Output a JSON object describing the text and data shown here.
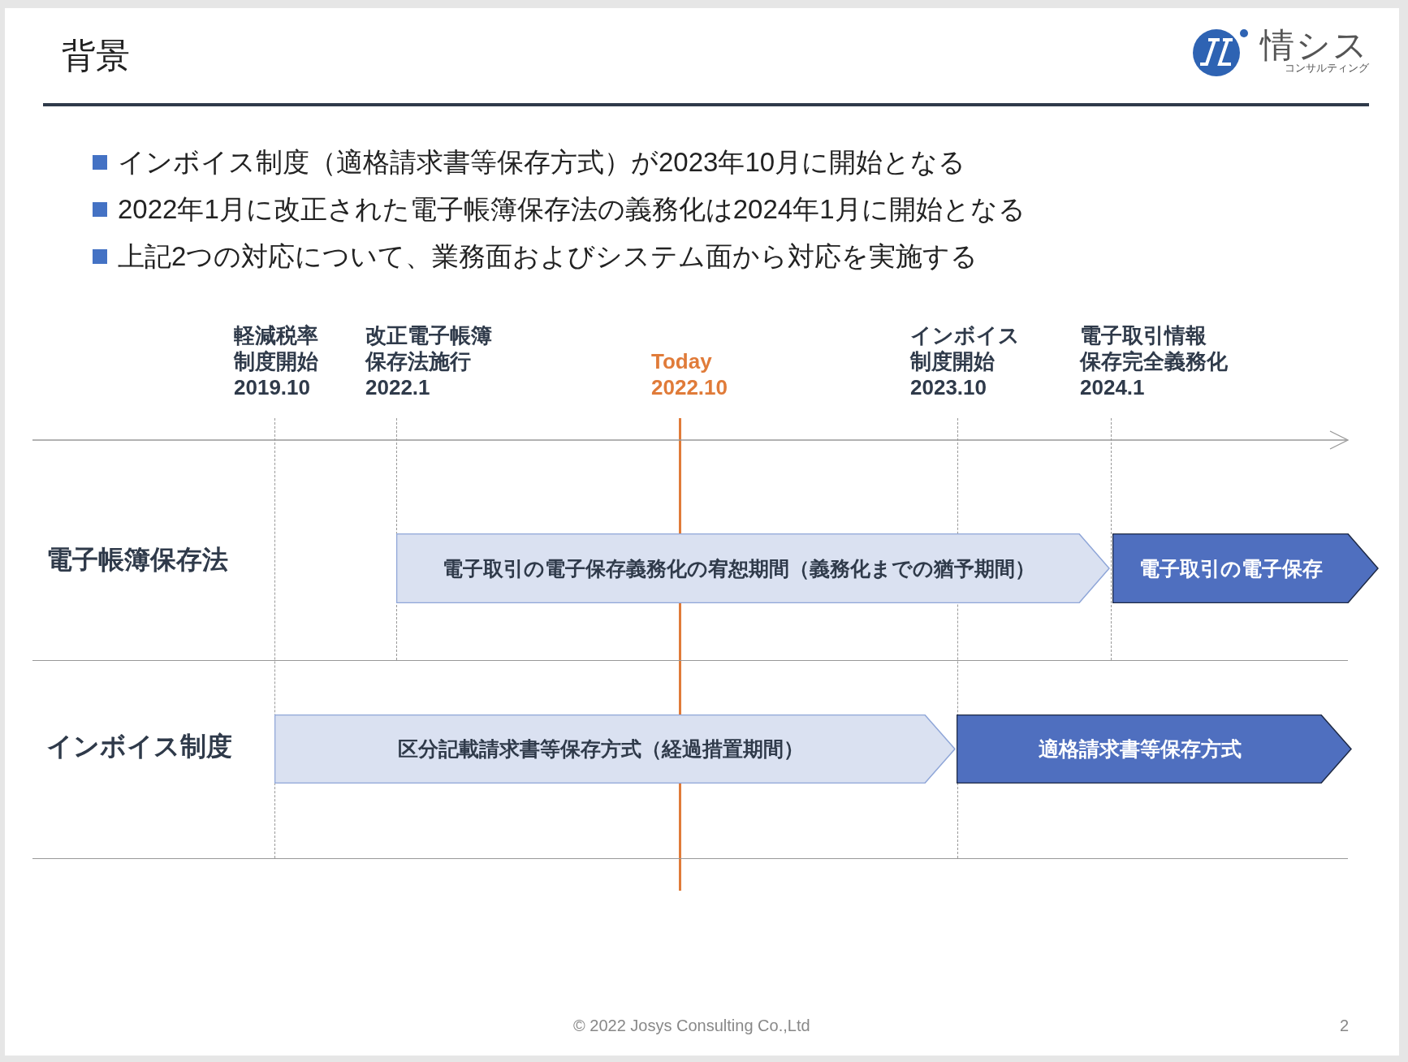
{
  "slide": {
    "title": "背景",
    "logo": {
      "name": "情シス",
      "subtitle": "コンサルティング"
    }
  },
  "bullets": [
    "インボイス制度（適格請求書等保存方式）が2023年10月に開始となる",
    "2022年1月に改正された電子帳簿保存法の義務化は2024年1月に開始となる",
    "上記2つの対応について、業務面およびシステム面から対応を実施する"
  ],
  "timeline": {
    "milestones": [
      {
        "kind": "event",
        "lines": [
          "軽減税率",
          "制度開始",
          "2019.10"
        ]
      },
      {
        "kind": "event",
        "lines": [
          "改正電子帳簿",
          "保存法施行",
          "2022.1"
        ]
      },
      {
        "kind": "today",
        "lines": [
          "Today",
          "2022.10"
        ]
      },
      {
        "kind": "event",
        "lines": [
          "インボイス",
          "制度開始",
          "2023.10"
        ]
      },
      {
        "kind": "event",
        "lines": [
          "電子取引情報",
          "保存完全義務化",
          "2024.1"
        ]
      }
    ],
    "rows": [
      {
        "label": "電子帳簿保存法",
        "phases": [
          {
            "kind": "transition",
            "text": "電子取引の電子保存義務化の宥恕期間（義務化までの猶予期間）"
          },
          {
            "kind": "mandatory",
            "text": "電子取引の電子保存"
          }
        ]
      },
      {
        "label": "インボイス制度",
        "phases": [
          {
            "kind": "transition",
            "text": "区分記載請求書等保存方式（経過措置期間）"
          },
          {
            "kind": "mandatory",
            "text": "適格請求書等保存方式"
          }
        ]
      }
    ]
  },
  "footer": {
    "copyright": "© 2022 Josys Consulting Co.,Ltd",
    "page_number": "2"
  }
}
